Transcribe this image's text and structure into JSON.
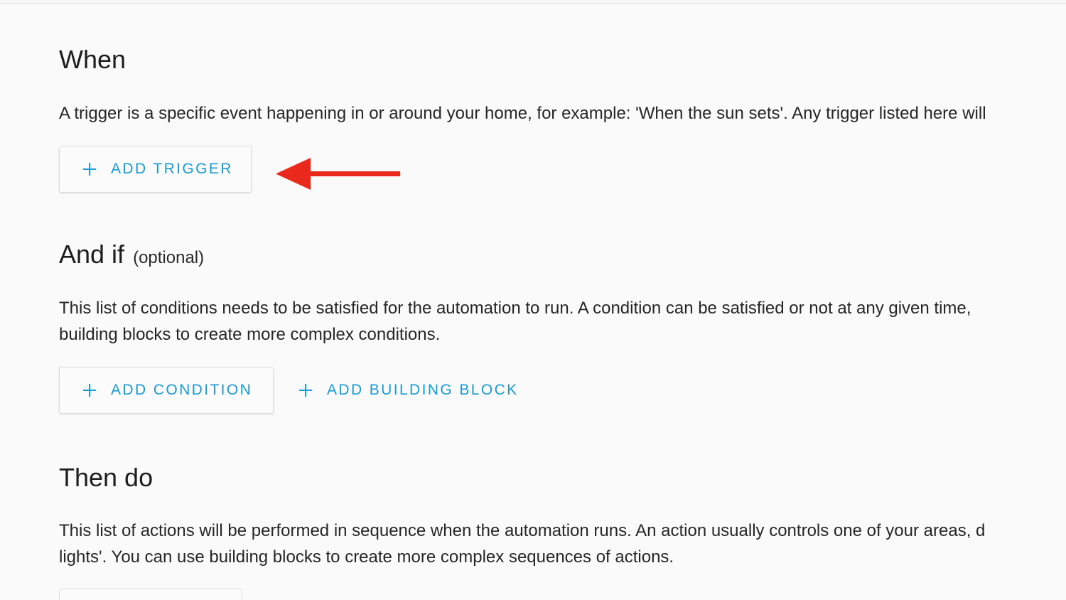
{
  "sections": {
    "when": {
      "title": "When",
      "description": "A trigger is a specific event happening in or around your home, for example: 'When the sun sets'. Any trigger listed here will",
      "add_trigger_label": "ADD TRIGGER"
    },
    "and_if": {
      "title": "And if",
      "optional": "(optional)",
      "description_line1": "This list of conditions needs to be satisfied for the automation to run. A condition can be satisfied or not at any given time,",
      "description_line2": "building blocks to create more complex conditions.",
      "add_condition_label": "ADD CONDITION",
      "add_building_block_label": "ADD BUILDING BLOCK"
    },
    "then_do": {
      "title": "Then do",
      "description_line1": "This list of actions will be performed in sequence when the automation runs. An action usually controls one of your areas, d",
      "description_line2": "lights'. You can use building blocks to create more complex sequences of actions."
    }
  },
  "colors": {
    "accent": "#1a9ad6",
    "annotation_arrow": "#e8291c",
    "background": "#fafafa"
  },
  "icons": {
    "add": "plus-icon",
    "annotation": "arrow-left-icon"
  }
}
